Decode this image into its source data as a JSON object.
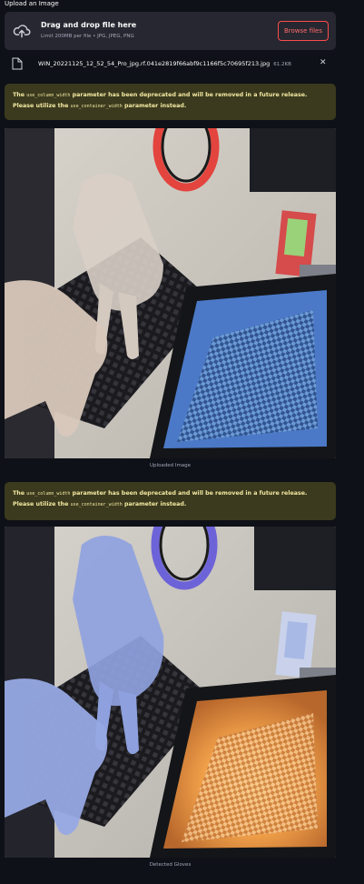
{
  "uploader": {
    "label": "Upload an Image",
    "drop_title": "Drag and drop file here",
    "drop_limit": "Limit 200MB per file • JPG, JPEG, PNG",
    "browse_label": "Browse files"
  },
  "file": {
    "name": "WIN_20221125_12_52_54_Pro_jpg.rf.041e2819f66abf9c1166f5c70695f213.jpg",
    "size": "61.2KB",
    "close_glyph": "✕"
  },
  "warning": {
    "prefix": "The ",
    "param_old": "use_column_width",
    "middle": " parameter has been deprecated and will be removed in a future release. Please utilize the ",
    "param_new": "use_container_width",
    "suffix": " parameter instead."
  },
  "images": [
    {
      "caption": "Uploaded Image",
      "tint": "natural"
    },
    {
      "caption": "Detected Gloves",
      "tint": "blue-orange"
    }
  ],
  "colors": {
    "background": "#0e1117",
    "panel": "#262730",
    "accent": "#ff4b4b",
    "warning_bg": "#3b3a1e",
    "warning_text": "#f4e9a2"
  }
}
